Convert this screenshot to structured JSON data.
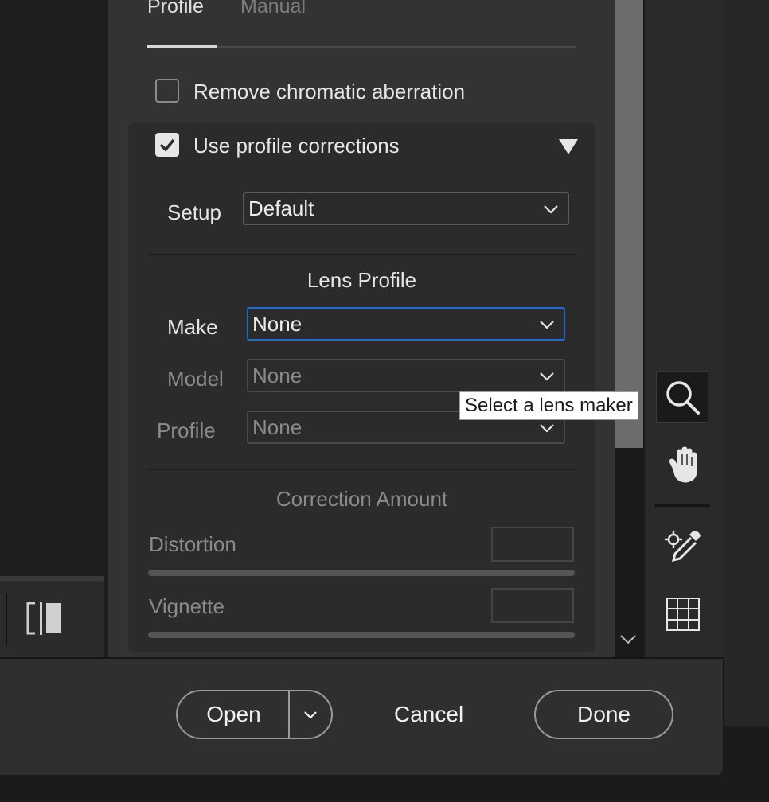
{
  "tabs": [
    {
      "label": "Profile",
      "active": true
    },
    {
      "label": "Manual",
      "active": false
    }
  ],
  "remove_chromatic": {
    "label": "Remove chromatic aberration",
    "checked": false
  },
  "use_profile": {
    "label": "Use profile corrections",
    "checked": true
  },
  "setup": {
    "label": "Setup",
    "value": "Default"
  },
  "lens_profile": {
    "title": "Lens Profile",
    "make": {
      "label": "Make",
      "value": "None"
    },
    "model": {
      "label": "Model",
      "value": "None"
    },
    "profile": {
      "label": "Profile",
      "value": "None"
    }
  },
  "tooltip": "Select a lens maker",
  "correction": {
    "title": "Correction Amount",
    "distortion": {
      "label": "Distortion",
      "value": ""
    },
    "vignette": {
      "label": "Vignette",
      "value": ""
    }
  },
  "footer": {
    "open_label": "Open",
    "cancel_label": "Cancel",
    "done_label": "Done"
  },
  "icons": {
    "collapse": "triangle-down-icon",
    "tools": [
      "zoom-icon",
      "hand-icon",
      "color-sampler-icon",
      "grid-icon"
    ],
    "compare": "before-after-icon"
  },
  "colors": {
    "focus": "#1d6ad1",
    "panel": "#333333",
    "card": "#2b2b2b"
  }
}
